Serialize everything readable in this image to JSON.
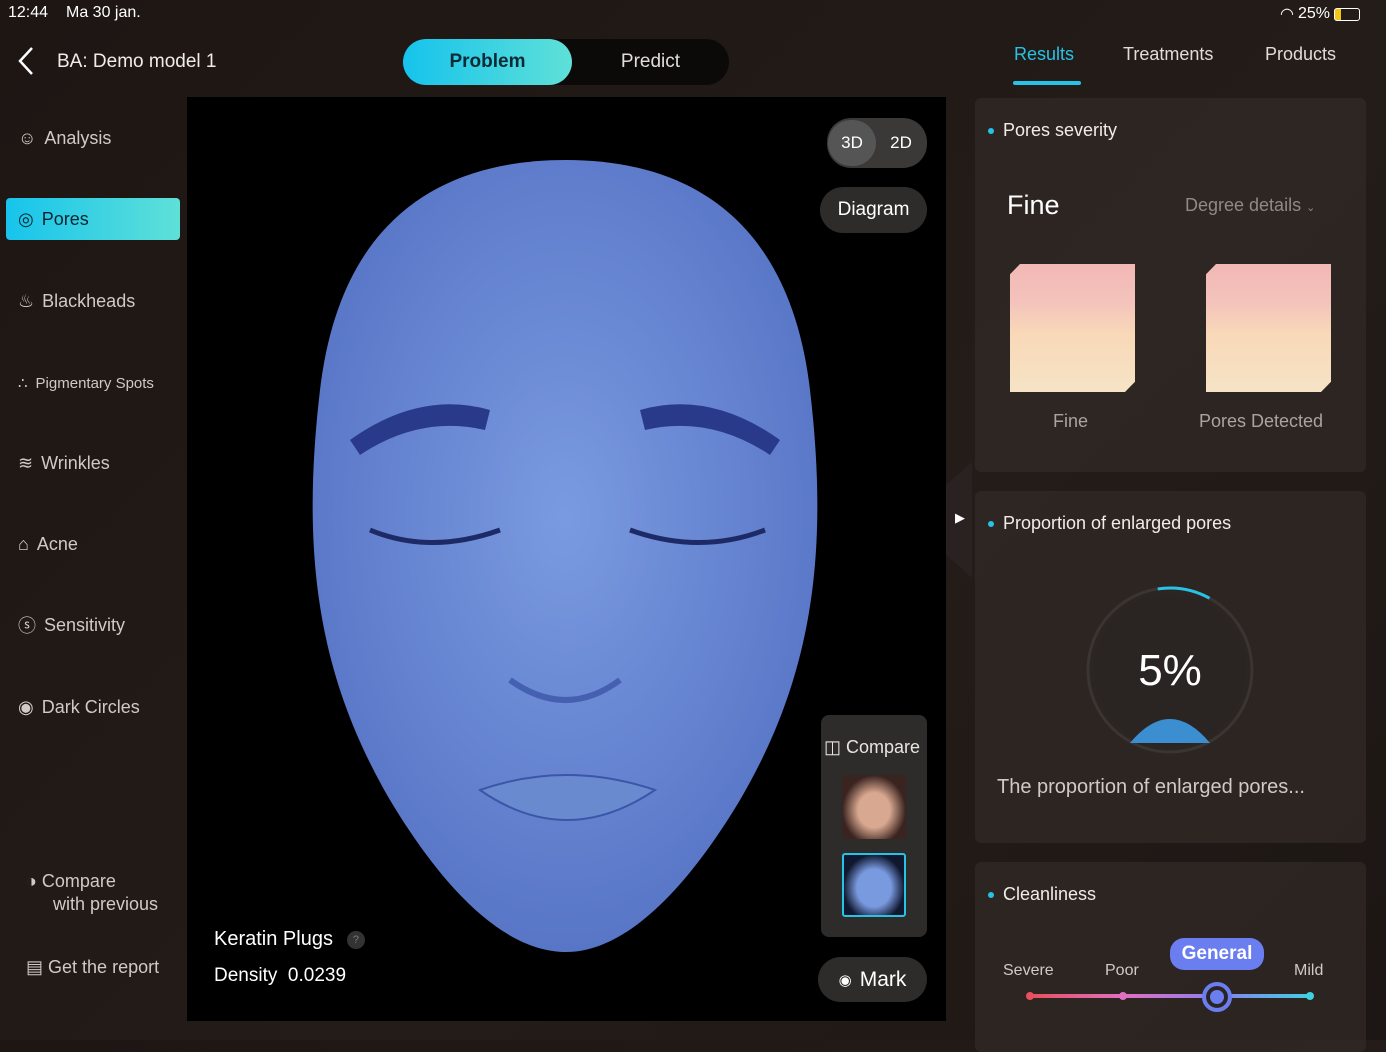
{
  "status": {
    "time": "12:44",
    "date": "Ma 30 jan.",
    "battery": "25%"
  },
  "header": {
    "title": "BA: Demo model 1",
    "segments": [
      "Problem",
      "Predict"
    ],
    "tabs": [
      "Results",
      "Treatments",
      "Products"
    ]
  },
  "sidebar": {
    "items": [
      {
        "label": "Analysis",
        "icon": "smile-icon"
      },
      {
        "label": "Pores",
        "icon": "target-icon"
      },
      {
        "label": "Blackheads",
        "icon": "blackheads-icon"
      },
      {
        "label": "Pigmentary Spots",
        "icon": "spots-icon"
      },
      {
        "label": "Wrinkles",
        "icon": "wrinkles-icon"
      },
      {
        "label": "Acne",
        "icon": "acne-icon"
      },
      {
        "label": "Sensitivity",
        "icon": "sensitivity-icon"
      },
      {
        "label": "Dark Circles",
        "icon": "eye-icon"
      }
    ],
    "compare_line1": "Compare",
    "compare_line2": "with previous",
    "report": "Get the report"
  },
  "viewer": {
    "mode3d": "3D",
    "mode2d": "2D",
    "diagram": "Diagram",
    "compare": "Compare",
    "metric": "Keratin Plugs",
    "density_label": "Density",
    "density_value": "0.0239",
    "mark": "Mark"
  },
  "results": {
    "severity": {
      "title": "Pores severity",
      "level": "Fine",
      "degree": "Degree details",
      "images": [
        "Fine",
        "Pores Detected"
      ]
    },
    "proportion": {
      "title": "Proportion of enlarged pores",
      "value": "5%",
      "percent": 5,
      "desc": "The proportion of enlarged pores..."
    },
    "cleanliness": {
      "title": "Cleanliness",
      "levels": [
        "Severe",
        "Poor",
        "General",
        "Mild"
      ],
      "selected": "General"
    }
  },
  "colors": {
    "accent": "#27c2e6",
    "slider": "#6b7ef0"
  }
}
